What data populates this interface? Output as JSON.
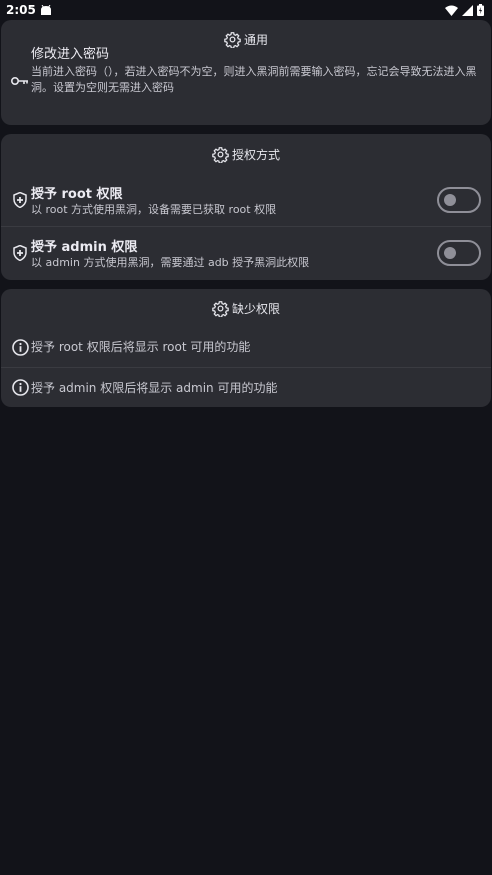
{
  "statusbar": {
    "time": "2:05"
  },
  "general": {
    "header": "通用",
    "password_title": "修改进入密码",
    "password_desc": "当前进入密码（），若进入密码不为空，则进入黑洞前需要输入密码，忘记会导致无法进入黑洞。设置为空则无需进入密码"
  },
  "auth": {
    "header": "授权方式",
    "root_title": "授予 root 权限",
    "root_desc": "以 root 方式使用黑洞，设备需要已获取 root 权限",
    "root_enabled": false,
    "admin_title": "授予 admin 权限",
    "admin_desc": "以 admin 方式使用黑洞，需要通过 adb 授予黑洞此权限",
    "admin_enabled": false
  },
  "missing": {
    "header": "缺少权限",
    "root_info": "授予 root 权限后将显示 root 可用的功能",
    "admin_info": "授予 admin 权限后将显示 admin 可用的功能"
  }
}
